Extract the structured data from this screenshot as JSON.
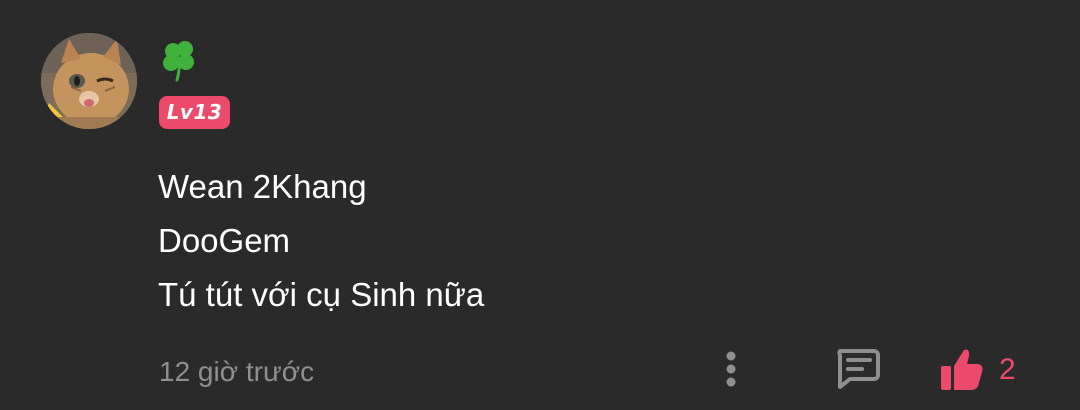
{
  "comment": {
    "avatar_icon": "cat-avatar",
    "flair_icon": "four-leaf-clover-icon",
    "level_badge": "Lv13",
    "lines": [
      "Wean 2Khang",
      "DooGem",
      "Tú tút với cụ Sinh nữa"
    ],
    "timestamp": "12 giờ trước",
    "actions": {
      "more_icon": "more-vertical-icon",
      "reply_icon": "reply-comment-icon",
      "like_icon": "thumbs-up-icon",
      "like_count": "2"
    }
  },
  "colors": {
    "background": "#2a2a2b",
    "accent": "#ec4a6a",
    "text": "#ffffff",
    "muted": "#8f8f90",
    "clover": "#3fb23c"
  }
}
